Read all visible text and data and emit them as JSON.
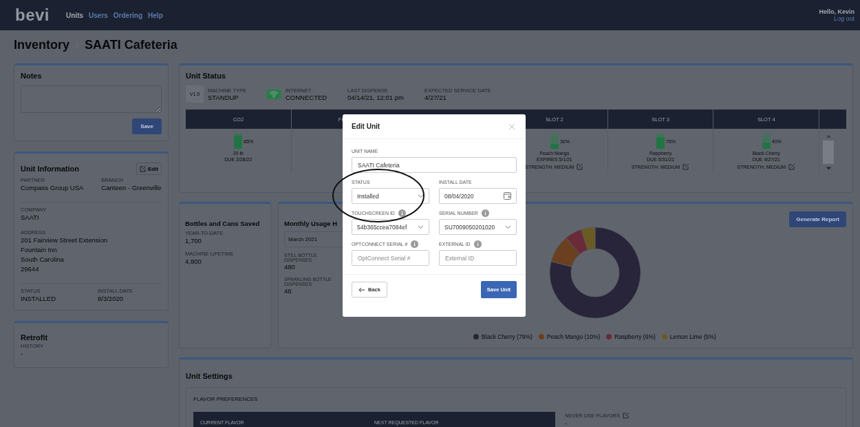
{
  "top_bar": {
    "logo": "bevi",
    "nav": [
      {
        "label": "Units",
        "selected": true
      },
      {
        "label": "Users",
        "selected": false
      },
      {
        "label": "Ordering",
        "selected": false
      },
      {
        "label": "Help",
        "selected": false
      }
    ],
    "greeting": "Hello, Kevin",
    "logout": "Log out"
  },
  "breadcrumb": [
    "Inventory",
    "SAATI Cafeteria"
  ],
  "notes": {
    "title": "Notes",
    "save": "Save"
  },
  "unit_information": {
    "title": "Unit Information",
    "edit": "Edit",
    "groups": [
      [
        {
          "label": "PARTNER",
          "lines": [
            "Compass Group USA"
          ]
        },
        {
          "label": "BRANCH",
          "lines": [
            "Canteen - Greenville"
          ]
        }
      ],
      [
        {
          "label": "COMPANY",
          "lines": [
            "SAATI"
          ]
        }
      ],
      [
        {
          "label": "ADDRESS",
          "lines": [
            "201 Fairview Street Extension",
            "Fountain Inn",
            "South Carolina",
            "29644"
          ]
        }
      ],
      [
        {
          "label": "STATUS",
          "lines": [
            "INSTALLED"
          ]
        },
        {
          "label": "INSTALL DATE",
          "lines": [
            "8/3/2020"
          ]
        }
      ]
    ]
  },
  "retrofit": {
    "title": "Retrofit",
    "label": "HISTORY",
    "value": "-"
  },
  "unit_status": {
    "title": "Unit Status",
    "stats": [
      {
        "kind": "badge",
        "badge": "V1.5",
        "label": "MACHINE TYPE",
        "value": "STANDUP"
      },
      {
        "kind": "wifi",
        "label": "INTERNET",
        "value": "CONNECTED"
      },
      {
        "kind": "plain",
        "label": "LAST DISPENSE",
        "value": "04/14/21, 12:01 pm"
      },
      {
        "kind": "plain",
        "label": "EXPECTED SERVICE DATE",
        "value": "4/27/21"
      }
    ],
    "slots": [
      {
        "kind": "co2",
        "header": "CO2",
        "level": 0.85,
        "reading": "85%",
        "lines": [
          "20 lb",
          "DUE 2/28/22"
        ]
      },
      {
        "kind": "partial",
        "header": "FI"
      },
      {
        "kind": "hidden"
      },
      {
        "kind": "flavor",
        "header": "SLOT 2",
        "level": 0.3,
        "reading": "30%",
        "lines": [
          "Peach Mango",
          "EXPIRES 5/1/21"
        ],
        "strength": "STRENGTH: MEDIUM"
      },
      {
        "kind": "flavor",
        "header": "SLOT 3",
        "level": 0.76,
        "reading": "76%",
        "lines": [
          "Raspberry",
          "DUE 5/31/21"
        ],
        "strength": "STRENGTH: MEDIUM"
      },
      {
        "kind": "flavor",
        "header": "SLOT 4",
        "level": 0.4,
        "reading": "40%",
        "lines": [
          "Black Cherry",
          "DUE 4/27/21"
        ],
        "strength": "STRENGTH: MEDIUM"
      }
    ]
  },
  "bottles": {
    "title": "Bottles and Cans Saved",
    "stats": [
      {
        "label": "YEAR-TO-DATE",
        "value": "1,700"
      },
      {
        "label": "MACHINE LIFETIME",
        "value": "4,800"
      }
    ]
  },
  "monthly_usage": {
    "title": "Monthly Usage H",
    "month": "March 2021",
    "stats": [
      {
        "label": "STILL BOTTLE DISPENSES",
        "value": "480"
      },
      {
        "label": "SPARKLING BOTTLE DISPENSES",
        "value": "48"
      }
    ],
    "report_button": "Generate Report",
    "chart_data": {
      "type": "donut",
      "categories": [
        "Black Cherry (79%)",
        "Peach Mango (10%)",
        "Raspberry (6%)",
        "Lemon Lime (5%)"
      ],
      "values": [
        79,
        10,
        6,
        5
      ],
      "legend": "bottom",
      "colors": [
        "#28243a",
        "#6a4020",
        "#6a2a38",
        "#6b5a22"
      ]
    }
  },
  "unit_settings": {
    "title": "Unit Settings",
    "section": "FLAVOR PREFERENCES",
    "columns": [
      "CURRENT FLAVOR",
      "NEXT REQUESTED FLAVOR"
    ],
    "never_use": {
      "label": "NEVER USE FLAVORS",
      "value": "-"
    }
  },
  "modal": {
    "title": "Edit Unit",
    "fields": [
      {
        "kind": "text",
        "label": "UNIT NAME",
        "info": false,
        "value": "SAATI Cafeteria",
        "wide": true
      },
      {
        "kind": "select",
        "label": "STATUS",
        "info": false,
        "value": "Installed"
      },
      {
        "kind": "date",
        "label": "INSTALL DATE",
        "info": false,
        "value": "08/04/2020"
      },
      {
        "kind": "select",
        "label": "TOUCHSCREEN ID",
        "info": true,
        "value": "54b365ccea7084ef"
      },
      {
        "kind": "select",
        "label": "SERIAL NUMBER",
        "info": true,
        "value": "SU7009050201020"
      },
      {
        "kind": "text",
        "label": "OPTCONNECT SERIAL #",
        "info": true,
        "placeholder": "OptConnect Serial #"
      },
      {
        "kind": "text",
        "label": "EXTERNAL ID",
        "info": true,
        "placeholder": "External ID"
      }
    ],
    "back": "Back",
    "save": "Save Unit"
  },
  "annotations": [
    {
      "kind": "ellipse"
    }
  ]
}
